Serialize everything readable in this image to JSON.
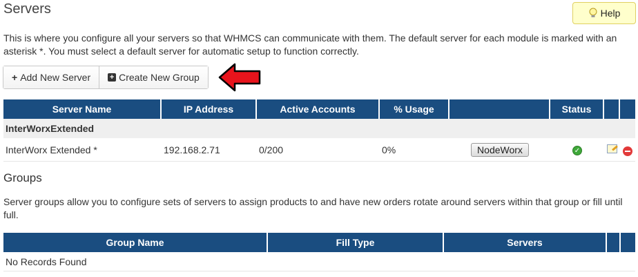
{
  "page": {
    "title": "Servers",
    "help_label": "Help",
    "help_icon": "lightbulb-icon",
    "intro": "This is where you configure all your servers so that WHMCS can communicate with them. The default server for each module is marked with an asterisk *. You must select a default server for automatic setup to function correctly."
  },
  "actions": {
    "add_server": "Add New Server",
    "create_group": "Create New Group"
  },
  "servers_table": {
    "headers": [
      "Server Name",
      "IP Address",
      "Active Accounts",
      "% Usage",
      "",
      "Status",
      "",
      ""
    ],
    "group_name": "InterWorxExtended",
    "rows": [
      {
        "name": "InterWorx Extended *",
        "ip": "192.168.2.71",
        "accounts": "0/200",
        "usage": "0%",
        "login_button": "NodeWorx",
        "status_icon": "check-circle-icon",
        "status_color": "#3fa83a"
      }
    ]
  },
  "groups": {
    "title": "Groups",
    "intro": "Server groups allow you to configure sets of servers to assign products to and have new orders rotate around servers within that group or fill until full.",
    "headers": [
      "Group Name",
      "Fill Type",
      "Servers",
      "",
      ""
    ],
    "empty": "No Records Found"
  },
  "colors": {
    "header_bg": "#1a4d80",
    "arrow": "#e8141c",
    "help_bg": "#ffffcc"
  }
}
